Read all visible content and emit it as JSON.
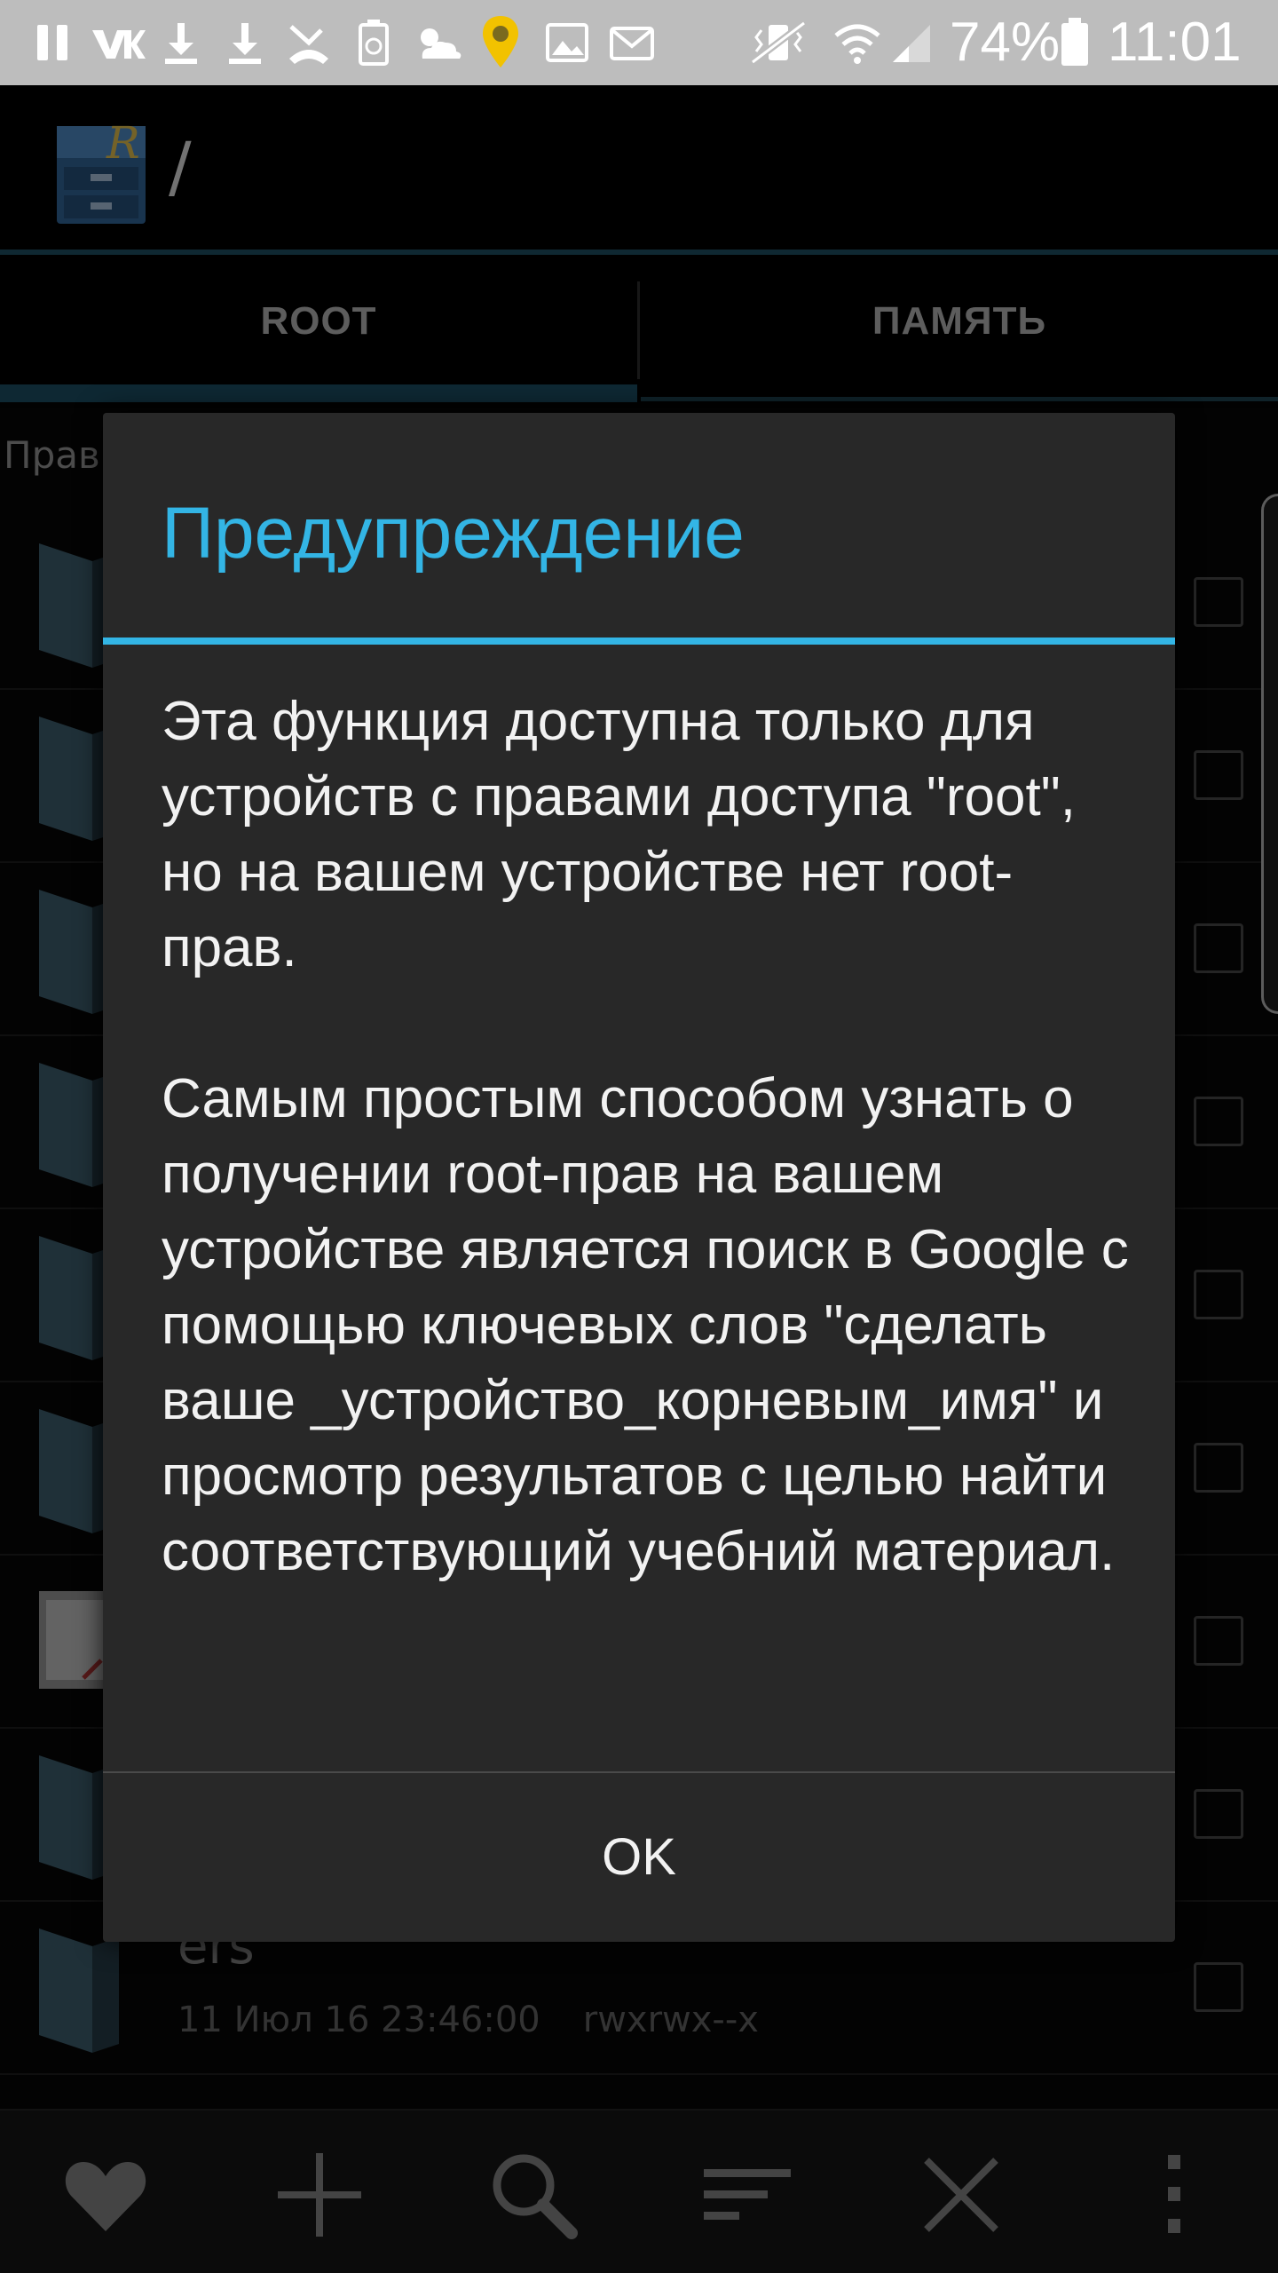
{
  "status_bar": {
    "battery_percent": "74%",
    "time": "11:01"
  },
  "action_bar": {
    "path": "/",
    "app_icon": "root-explorer-app-icon"
  },
  "tabs": [
    {
      "label": "ROOT",
      "selected": true
    },
    {
      "label": "ПАМЯТЬ",
      "selected": false
    }
  ],
  "file_list": {
    "header": "Прав",
    "visible_row": {
      "name": "ers",
      "date": "11 Июл 16 23:46:00",
      "permissions": "rwxrwx--x"
    }
  },
  "dialog": {
    "title": "Предупреждение",
    "message": "Эта функция доступна только для устройств с правами доступа \"root\", но на вашем устройстве нет root-прав.\n\nСамым простым способом узнать о получении root-прав на вашем устройстве является поиск в Google с помощью ключевых слов \"сделать ваше _устройство_корневым_имя\" и просмотр результатов с целью найти соответствующий учебний материал.",
    "ok_label": "OK"
  },
  "bottom_toolbar": [
    {
      "icon": "heart-icon"
    },
    {
      "icon": "plus-icon"
    },
    {
      "icon": "search-icon"
    },
    {
      "icon": "sort-icon"
    },
    {
      "icon": "close-icon"
    },
    {
      "icon": "more-vertical-icon"
    }
  ],
  "colors": {
    "accent": "#33b5e5",
    "dialog_bg": "#282828",
    "status_bar": "#bdbdbd"
  }
}
